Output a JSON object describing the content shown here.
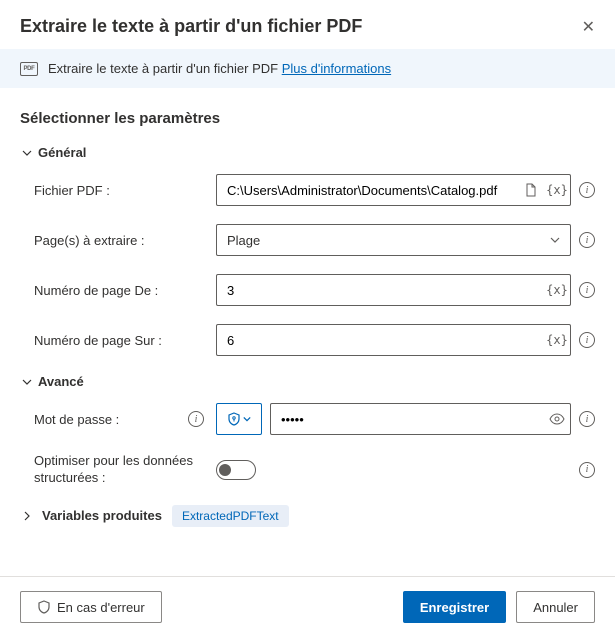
{
  "header": {
    "title": "Extraire le texte à partir d'un fichier PDF"
  },
  "banner": {
    "text": "Extraire le texte à partir d'un fichier PDF",
    "link": "Plus d'informations"
  },
  "section_title": "Sélectionner les paramètres",
  "groups": {
    "general": "Général",
    "advanced": "Avancé"
  },
  "fields": {
    "pdf_file": {
      "label": "Fichier PDF :",
      "value": "C:\\Users\\Administrator\\Documents\\Catalog.pdf"
    },
    "pages": {
      "label": "Page(s) à extraire :",
      "value": "Plage"
    },
    "from": {
      "label": "Numéro de page De :",
      "value": "3"
    },
    "to": {
      "label": "Numéro de page Sur :",
      "value": "6"
    },
    "password": {
      "label": "Mot de passe :",
      "value": "•••••"
    },
    "optimize": {
      "label": "Optimiser pour les données structurées :"
    }
  },
  "vars": {
    "label": "Variables produites",
    "pill": "ExtractedPDFText"
  },
  "footer": {
    "error": "En cas d'erreur",
    "save": "Enregistrer",
    "cancel": "Annuler"
  }
}
